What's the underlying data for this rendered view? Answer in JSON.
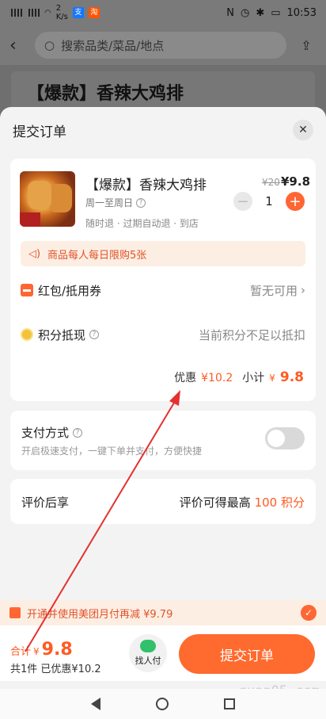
{
  "status": {
    "network_speed": "2",
    "speed_unit": "K/s",
    "time": "10:53"
  },
  "search": {
    "placeholder": "搜索品类/菜品/地点"
  },
  "bg_title": "【爆款】香辣大鸡排",
  "sheet": {
    "title": "提交订单"
  },
  "item": {
    "name": "【爆款】香辣大鸡排",
    "old_price": "¥20",
    "new_price": "¥9.8",
    "days": "周一至周日",
    "qty": "1",
    "tags": "随时退 · 过期自动退 · 到店"
  },
  "limit_notice": "商品每人每日限购5张",
  "coupon": {
    "label": "红包/抵用券",
    "value": "暂无可用"
  },
  "points": {
    "label": "积分抵现",
    "value": "当前积分不足以抵扣"
  },
  "subtotal": {
    "discount_label": "优惠",
    "discount": "¥10.2",
    "label": "小计",
    "yen": "¥",
    "amount": "9.8"
  },
  "payment": {
    "title": "支付方式",
    "subtitle": "开启极速支付，一键下单并支付，方便快捷"
  },
  "review": {
    "left": "评价后享",
    "right_prefix": "评价可得最高",
    "right_value": "100 积分"
  },
  "monthly_pay": "开通并使用美团月付再减 ¥9.79",
  "bottom": {
    "total_label": "合计",
    "yen": "¥",
    "total": "9.8",
    "count": "共1件  已优惠¥10.2",
    "helper": "找人付",
    "submit": "提交订单"
  },
  "watermark": "quan05.com",
  "colors": {
    "accent": "#ff6a2e",
    "price": "#ff5a22",
    "notice_bg": "#fdeee3"
  }
}
